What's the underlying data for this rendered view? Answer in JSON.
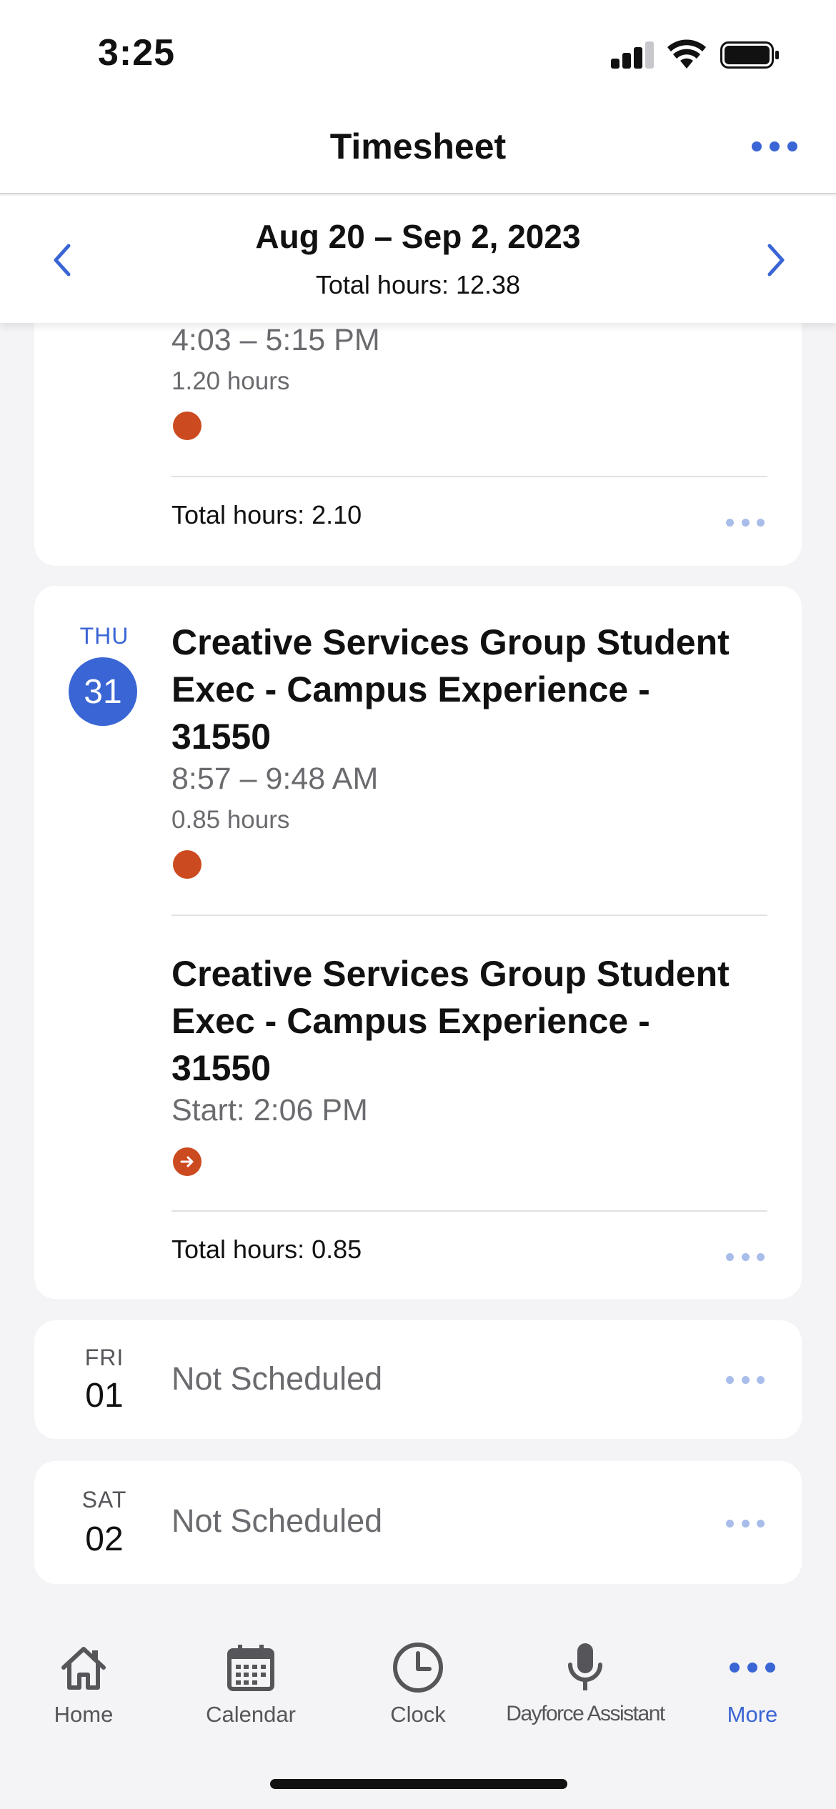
{
  "status_bar": {
    "time": "3:25"
  },
  "header": {
    "title": "Timesheet"
  },
  "range": {
    "title": "Aug 20 – Sep 2, 2023",
    "total": "Total hours: 12.38"
  },
  "prev_day": {
    "entry": {
      "time": "4:03 – 5:15 PM",
      "hours": "1.20 hours"
    },
    "total": "Total hours: 2.10"
  },
  "thursday": {
    "weekday": "THU",
    "day": "31",
    "entries": [
      {
        "title": "Creative Services Group Student Exec - Campus Experience - 31550",
        "time": "8:57 – 9:48 AM",
        "hours": "0.85 hours"
      },
      {
        "title": "Creative Services Group Student Exec - Campus Experience - 31550",
        "time": "Start: 2:06 PM"
      }
    ],
    "total": "Total hours: 0.85"
  },
  "friday": {
    "weekday": "FRI",
    "day": "01",
    "status": "Not Scheduled"
  },
  "saturday": {
    "weekday": "SAT",
    "day": "02",
    "status": "Not Scheduled"
  },
  "tabs": [
    {
      "label": "Home",
      "icon": "home-icon"
    },
    {
      "label": "Calendar",
      "icon": "calendar-icon"
    },
    {
      "label": "Clock",
      "icon": "clock-icon"
    },
    {
      "label": "Dayforce Assistant",
      "icon": "microphone-icon"
    },
    {
      "label": "More",
      "icon": "more-icon",
      "active": true
    }
  ],
  "colors": {
    "accent": "#3a65d4",
    "status_orange": "#cc4a1f",
    "muted_dots": "#a9bdea"
  }
}
